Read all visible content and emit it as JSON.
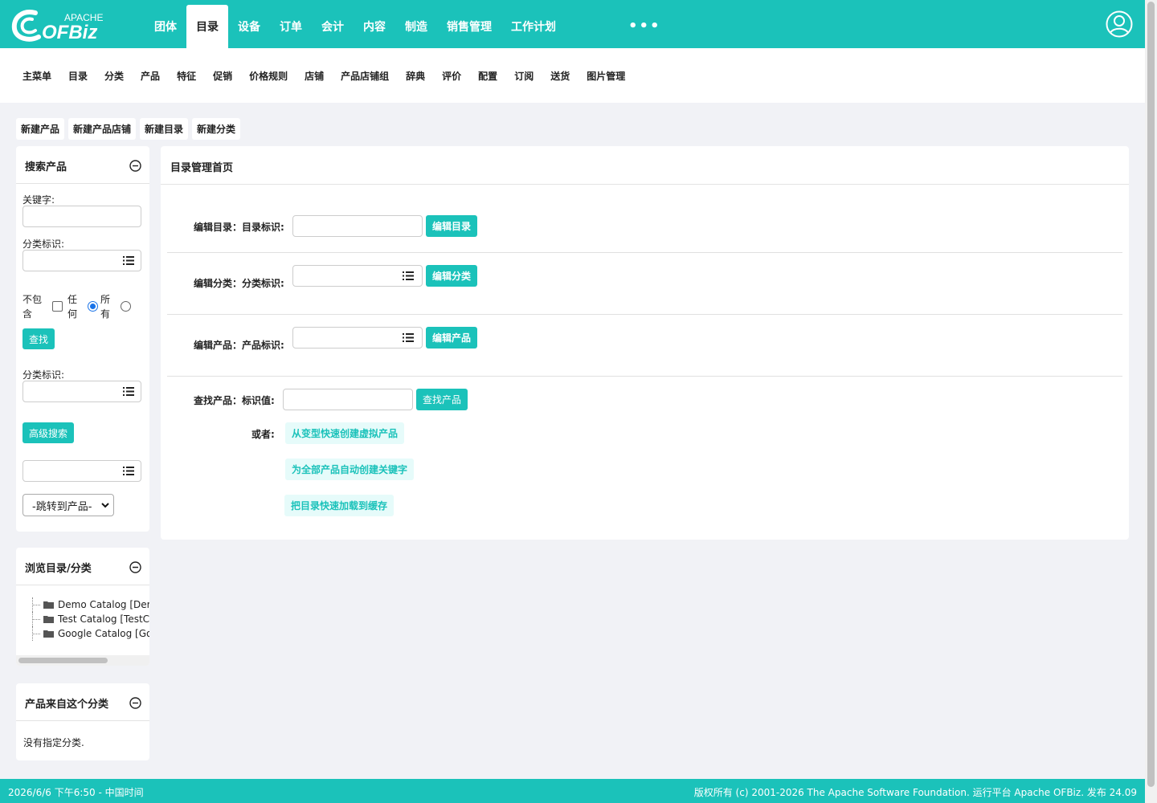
{
  "brand": {
    "logo_top": "APACHE",
    "logo_main": "OFBiz"
  },
  "main_nav": [
    "团体",
    "目录",
    "设备",
    "订单",
    "会计",
    "内容",
    "制造",
    "销售管理",
    "工作计划"
  ],
  "main_nav_active": "目录",
  "more_label": "•••",
  "sub_nav": [
    "主菜单",
    "目录",
    "分类",
    "产品",
    "特征",
    "促销",
    "价格规则",
    "店铺",
    "产品店铺组",
    "辞典",
    "评价",
    "配置",
    "订阅",
    "送货",
    "图片管理"
  ],
  "actions": [
    "新建产品",
    "新建产品店铺",
    "新建目录",
    "新建分类"
  ],
  "search_panel": {
    "title": "搜索产品",
    "keyword_label": "关键字:",
    "category_label": "分类标识:",
    "exclude_label": "不包含",
    "any_label": "任何",
    "all_label": "所有",
    "find_button": "查找",
    "category_label_2": "分类标识:",
    "advanced_button": "高级搜索",
    "jump_select": "-跳转到产品-"
  },
  "browse_panel": {
    "title": "浏览目录/分类",
    "items": [
      "Demo Catalog [DemoCatalog]",
      "Test Catalog [TestCatalog]",
      "Google Catalog [GoogleCatalog]"
    ]
  },
  "cats_panel": {
    "title": "产品来自这个分类",
    "empty_text": "没有指定分类."
  },
  "main": {
    "title": "目录管理首页",
    "edit_catalog_label": "编辑目录：目录标识:",
    "edit_catalog_button": "编辑目录",
    "edit_category_label": "编辑分类：分类标识:",
    "edit_category_button": "编辑分类",
    "edit_product_label": "编辑产品：产品标识:",
    "edit_product_button": "编辑产品",
    "find_product_label": "查找产品：标识值:",
    "find_product_button": "查找产品",
    "or_label": "或者:",
    "links": [
      "从变型快速创建虚拟产品",
      "为全部产品自动创建关键字",
      "把目录快速加载到缓存"
    ]
  },
  "footer": {
    "left": "2026/6/6 下午6:50 - 中国时间",
    "right": "版权所有 (c) 2001-2026 The Apache Software Foundation. 运行平台 Apache OFBiz. 发布 24.09"
  },
  "colors": {
    "accent": "#1bc2ba",
    "link_bg": "#e6fbfa",
    "page_bg": "#f1f2f6"
  }
}
